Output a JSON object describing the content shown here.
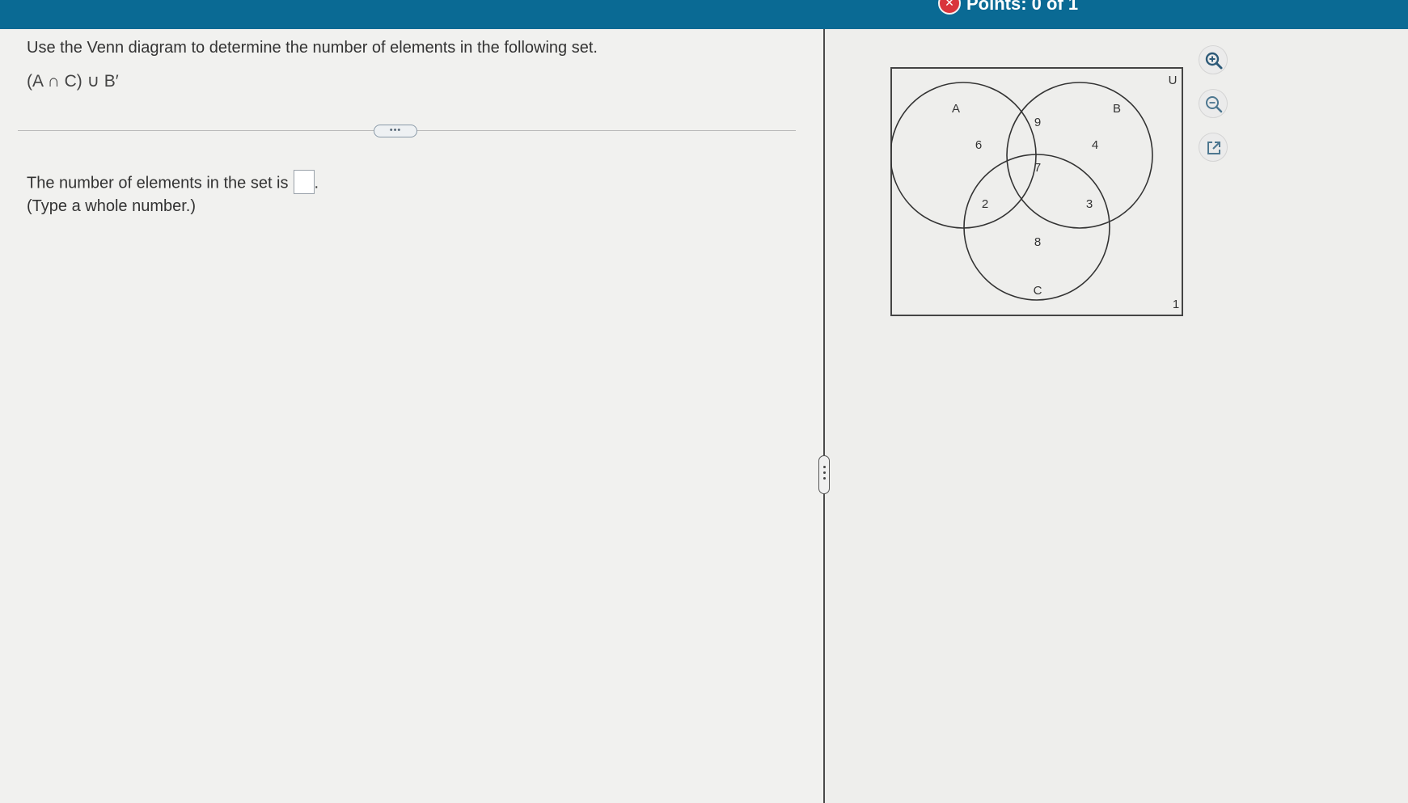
{
  "header": {
    "points_label": "Points: 0 of 1",
    "status_icon": "x-icon",
    "accent_color": "#0a6a94"
  },
  "question": {
    "prompt": "Use the Venn diagram to determine the number of elements in the following set.",
    "expression": "(A ∩ C) ∪ B′",
    "more_label": "•••",
    "answer_prefix": "The number of elements in the set is",
    "answer_suffix": ".",
    "answer_value": "",
    "hint": "(Type a whole number.)"
  },
  "venn": {
    "labels": {
      "A": "A",
      "B": "B",
      "C": "C",
      "U": "U"
    },
    "regions": {
      "a_only": "6",
      "a_b_only": "9",
      "b_only": "4",
      "a_b_c": "7",
      "a_c_only": "2",
      "b_c_only": "3",
      "c_only": "8",
      "outside": "1"
    }
  },
  "tools": {
    "zoom_in": "zoom-in-icon",
    "zoom_out": "zoom-out-icon",
    "open_external": "external-link-icon"
  }
}
